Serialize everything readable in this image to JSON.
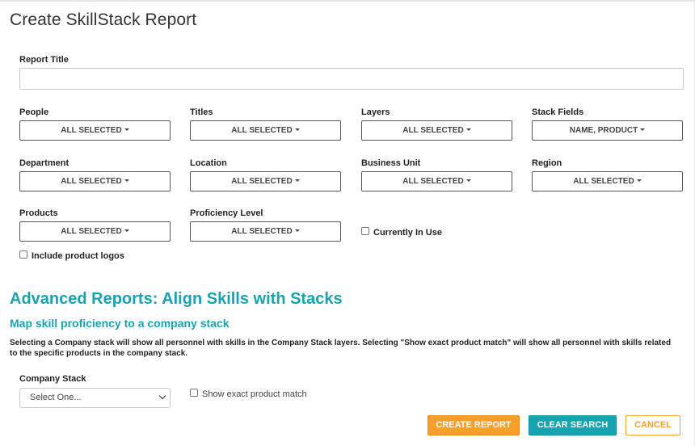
{
  "page": {
    "title": "Create SkillStack Report"
  },
  "report_title": {
    "label": "Report Title",
    "value": "",
    "placeholder": ""
  },
  "filters": {
    "people": {
      "label": "People",
      "value": "ALL SELECTED"
    },
    "titles": {
      "label": "Titles",
      "value": "ALL SELECTED"
    },
    "layers": {
      "label": "Layers",
      "value": "ALL SELECTED"
    },
    "stack_fields": {
      "label": "Stack Fields",
      "value": "NAME, PRODUCT"
    },
    "department": {
      "label": "Department",
      "value": "ALL SELECTED"
    },
    "location": {
      "label": "Location",
      "value": "ALL SELECTED"
    },
    "business_unit": {
      "label": "Business Unit",
      "value": "ALL SELECTED"
    },
    "region": {
      "label": "Region",
      "value": "ALL SELECTED"
    },
    "products": {
      "label": "Products",
      "value": "ALL SELECTED"
    },
    "proficiency": {
      "label": "Proficiency Level",
      "value": "ALL SELECTED"
    }
  },
  "options": {
    "currently_in_use": {
      "label": "Currently In Use",
      "checked": false
    },
    "include_logos": {
      "label": "Include product logos",
      "checked": false
    }
  },
  "advanced": {
    "title": "Advanced Reports: Align Skills with Stacks",
    "subtitle": "Map skill proficiency to a company stack",
    "description": "Selecting a Company stack will show all personnel with skills in the Company Stack layers. Selecting \"Show exact product match\" will show all personnel with skills related to the specific products in the company stack.",
    "company_stack_label": "Company Stack",
    "company_stack_value": "Select One...",
    "exact_match_label": "Show exact product match",
    "exact_match_checked": false
  },
  "actions": {
    "create": "CREATE REPORT",
    "clear": "CLEAR SEARCH",
    "cancel": "CANCEL"
  },
  "colors": {
    "accent": "#17a3b1",
    "orange": "#f5a02a"
  }
}
